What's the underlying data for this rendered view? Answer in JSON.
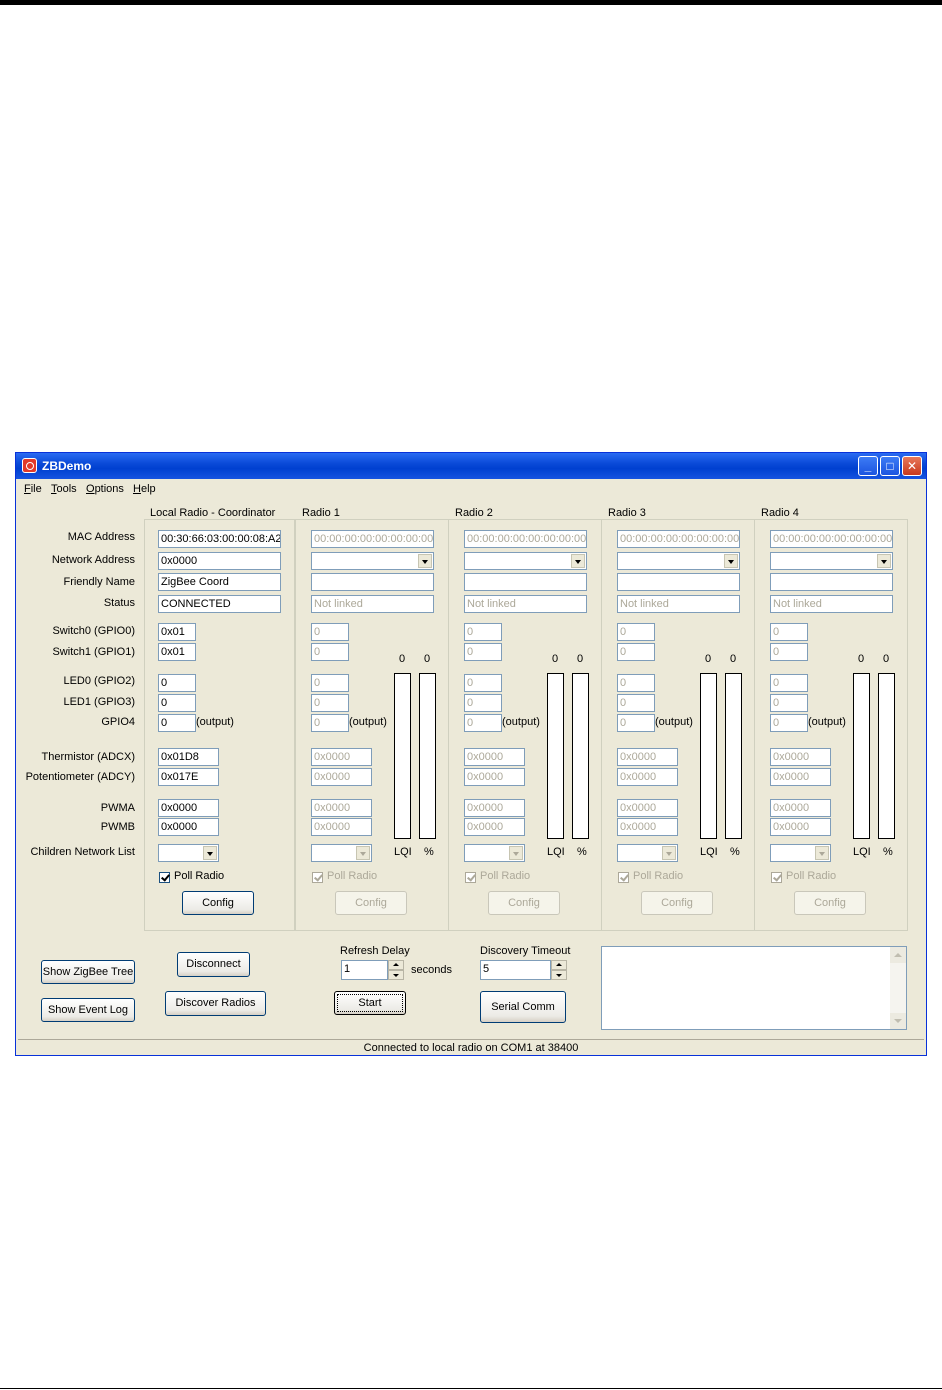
{
  "window": {
    "title": "ZBDemo"
  },
  "menu": [
    "File",
    "Tools",
    "Options",
    "Help"
  ],
  "labels": {
    "mac": "MAC Address",
    "network": "Network Address",
    "friendly": "Friendly Name",
    "status": "Status",
    "sw0": "Switch0 (GPIO0)",
    "sw1": "Switch1 (GPIO1)",
    "led0": "LED0 (GPIO2)",
    "led1": "LED1 (GPIO3)",
    "gpio4": "GPIO4",
    "therm": "Thermistor (ADCX)",
    "pot": "Potentiometer (ADCY)",
    "pwma": "PWMA",
    "pwmb": "PWMB",
    "children": "Children Network List",
    "output": "(output)",
    "lqi": "LQI",
    "pct": "%",
    "poll": "Poll Radio",
    "config": "Config"
  },
  "local": {
    "title": "Local Radio - Coordinator",
    "mac": "00:30:66:03:00:00:08:A2",
    "network": "0x0000",
    "friendly": "ZigBee Coord",
    "status": "CONNECTED",
    "sw0": "0x01",
    "sw1": "0x01",
    "led0": "0",
    "led1": "0",
    "gpio4": "0",
    "therm": "0x01D8",
    "pot": "0x017E",
    "pwma": "0x0000",
    "pwmb": "0x0000"
  },
  "remote": {
    "mac": "00:00:00:00:00:00:00:00",
    "status": "Not linked",
    "digital": "0",
    "analog": "0x0000",
    "lqi_value": "0",
    "pct_value": "0"
  },
  "radios": [
    {
      "title": "Radio 1"
    },
    {
      "title": "Radio 2"
    },
    {
      "title": "Radio 3"
    },
    {
      "title": "Radio 4"
    }
  ],
  "controls": {
    "show_tree": "Show ZigBee Tree",
    "show_log": "Show  Event Log",
    "disconnect": "Disconnect",
    "discover": "Discover Radios",
    "refresh_label": "Refresh Delay",
    "refresh_value": "1",
    "seconds": "seconds",
    "start": "Start",
    "discovery_label": "Discovery Timeout",
    "discovery_value": "5",
    "serial": "Serial Comm"
  },
  "status_text": "Connected to local radio on COM1 at 38400"
}
